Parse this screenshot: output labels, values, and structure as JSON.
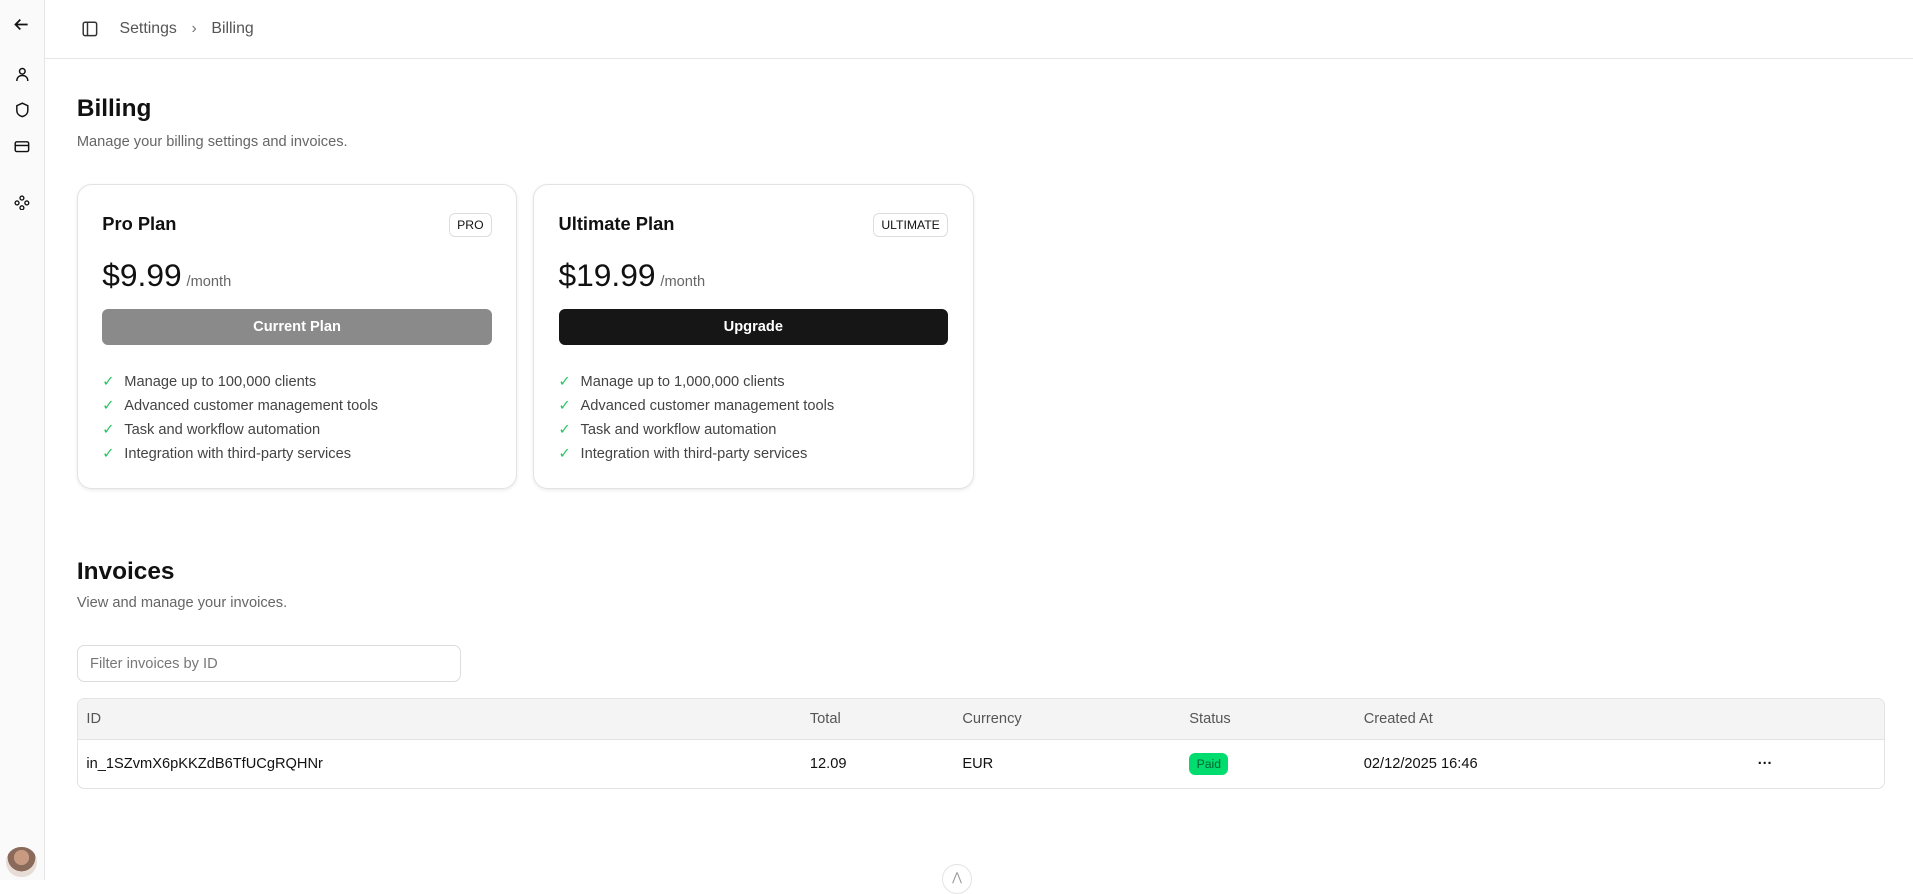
{
  "breadcrumb": {
    "root": "Settings",
    "current": "Billing"
  },
  "page": {
    "title": "Billing",
    "subtitle": "Manage your billing settings and invoices."
  },
  "plans": [
    {
      "name": "Pro Plan",
      "badge": "PRO",
      "price": "$9.99",
      "period": "/month",
      "button": "Current Plan",
      "features": [
        "Manage up to 100,000 clients",
        "Advanced customer management tools",
        "Task and workflow automation",
        "Integration with third-party services"
      ]
    },
    {
      "name": "Ultimate Plan",
      "badge": "ULTIMATE",
      "price": "$19.99",
      "period": "/month",
      "button": "Upgrade",
      "features": [
        "Manage up to 1,000,000 clients",
        "Advanced customer management tools",
        "Task and workflow automation",
        "Integration with third-party services"
      ]
    }
  ],
  "invoices": {
    "title": "Invoices",
    "subtitle": "View and manage your invoices.",
    "filter_placeholder": "Filter invoices by ID",
    "columns": [
      "ID",
      "Total",
      "Currency",
      "Status",
      "Created At"
    ],
    "rows": [
      {
        "id": "in_1SZvmX6pKKZdB6TfUCgRQHNr",
        "total": "12.09",
        "currency": "EUR",
        "status": "Paid",
        "created": "02/12/2025 16:46",
        "actions": "···"
      }
    ]
  },
  "colors": {
    "paid": "#00dc6e",
    "primary": "#161616",
    "disabled": "#8a8a8a"
  }
}
